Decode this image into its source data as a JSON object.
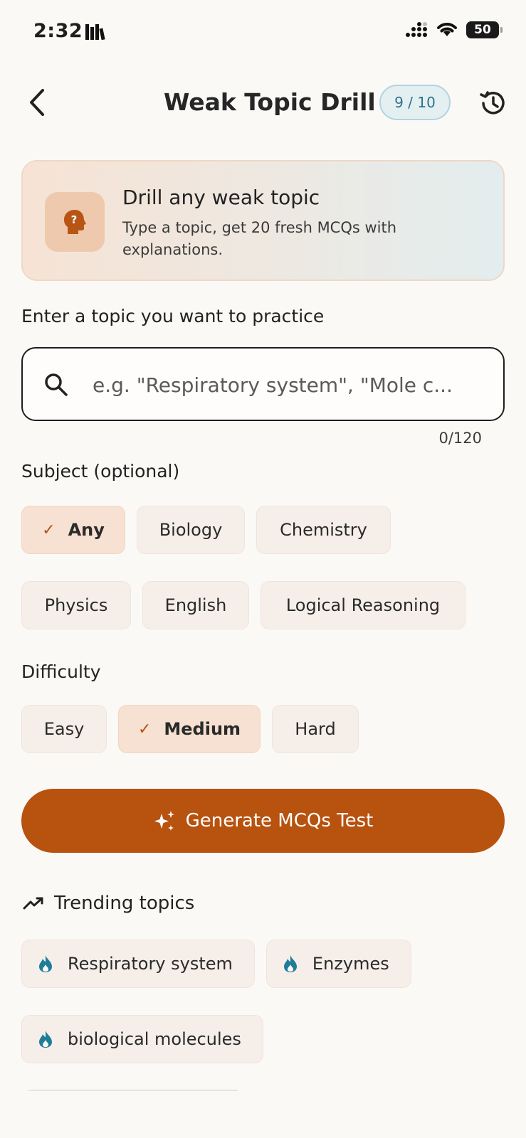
{
  "status_bar": {
    "time": "2:32",
    "battery": "50"
  },
  "header": {
    "title": "Weak Topic Drill",
    "quota": "9 / 10"
  },
  "info_card": {
    "title": "Drill any weak topic",
    "description": "Type a topic, get 20 fresh MCQs with explanations.",
    "icon": "head-question-icon"
  },
  "topic_section": {
    "label": "Enter a topic you want to practice",
    "search_placeholder": "e.g. \"Respiratory system\", \"Mole c...",
    "search_value": "",
    "char_count": "0/120"
  },
  "subject_section": {
    "label": "Subject (optional)",
    "options": [
      "Any",
      "Biology",
      "Chemistry",
      "Physics",
      "English",
      "Logical Reasoning"
    ],
    "selected": "Any"
  },
  "difficulty_section": {
    "label": "Difficulty",
    "options": [
      "Easy",
      "Medium",
      "Hard"
    ],
    "selected": "Medium"
  },
  "generate_button": {
    "label": "Generate MCQs Test"
  },
  "trending": {
    "label": "Trending topics",
    "topics": [
      "Respiratory system",
      "Enzymes",
      "biological molecules"
    ]
  },
  "colors": {
    "accent": "#b7520f",
    "badge_text": "#2c7389",
    "flame": "#1f7d9a"
  }
}
